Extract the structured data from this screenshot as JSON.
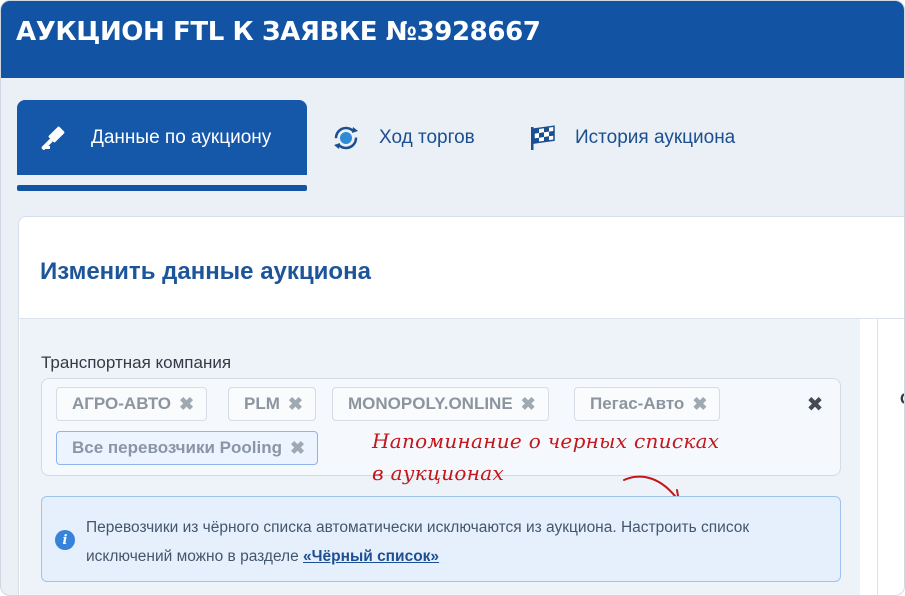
{
  "header": {
    "title": "АУКЦИОН FTL К ЗАЯВКЕ №3928667"
  },
  "tabs": [
    {
      "label": "Данные по аукциону",
      "icon": "gavel-icon",
      "active": true
    },
    {
      "label": "Ход торгов",
      "icon": "refresh-icon",
      "active": false
    },
    {
      "label": "История аукциона",
      "icon": "checkered-flag-icon",
      "active": false
    }
  ],
  "card": {
    "title": "Изменить данные аукциона"
  },
  "transport": {
    "label": "Транспортная компания",
    "tags": [
      "АГРО-АВТО",
      "PLM",
      "MONOPOLY.ONLINE",
      "Пегас-Авто",
      "Все перевозчики Pooling"
    ],
    "remove_glyph": "✖",
    "clear_glyph": "✖"
  },
  "annotation": {
    "line1": "Напоминание о черных списках",
    "line2": "в аукционах",
    "color": "#c3171b"
  },
  "info": {
    "text": "Перевозчики из чёрного списка автоматически исключаются из аукциона. Настроить список исключений можно в разделе ",
    "link": "«Чёрный список»"
  },
  "right_panel": {
    "label": "Ос"
  },
  "colors": {
    "brand": "#1254a3",
    "active_tab": "#1557a9",
    "accent_text": "#1d5599"
  }
}
